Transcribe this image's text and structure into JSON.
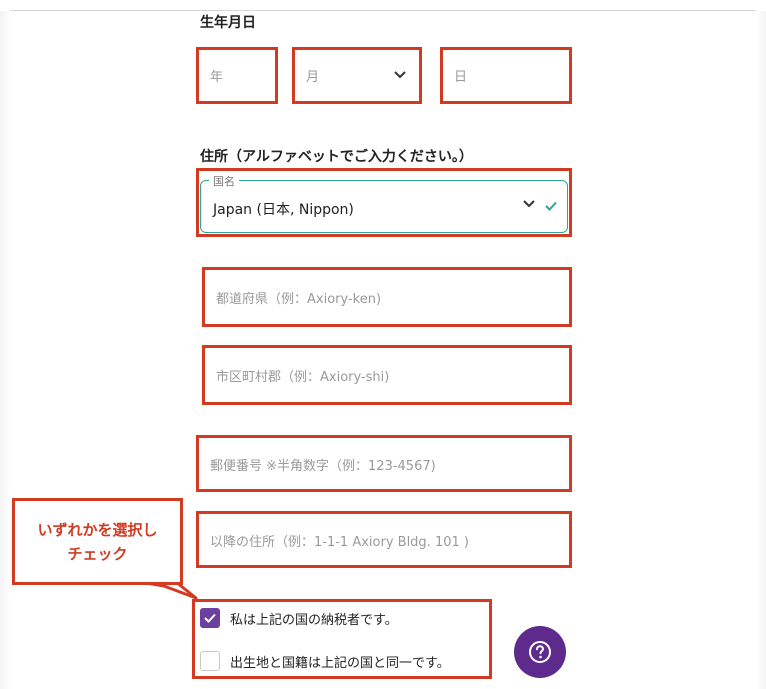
{
  "birthdate": {
    "label": "生年月日",
    "year_placeholder": "年",
    "month_placeholder": "月",
    "day_placeholder": "日"
  },
  "address": {
    "label": "住所（アルファベットでご入力ください。）",
    "country_legend": "国名",
    "country_value": "Japan (日本, Nippon)",
    "prefecture_placeholder": "都道府県（例：Axiory-ken)",
    "city_placeholder": "市区町村郡（例：Axiory-shi)",
    "postal_placeholder": "郵便番号 ※半角数字（例：123-4567)",
    "street_placeholder": "以降の住所（例：1-1-1 Axiory Bldg. 101 )"
  },
  "callout": {
    "line1": "いずれかを選択し",
    "line2": "チェック"
  },
  "checkboxes": [
    {
      "label": "私は上記の国の納税者です。",
      "checked": true
    },
    {
      "label": "出生地と国籍は上記の国と同一です。",
      "checked": false
    }
  ],
  "help": {
    "icon": "question-icon"
  },
  "colors": {
    "annotation_red": "#d33a22",
    "accent_purple": "#6c3fa0",
    "valid_teal": "#2aa59b"
  }
}
